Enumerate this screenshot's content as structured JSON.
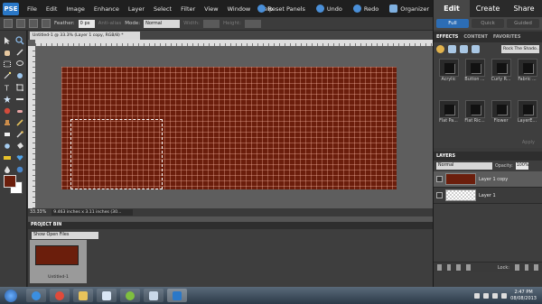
{
  "menubar": {
    "logo_text": "PSE",
    "items": [
      "File",
      "Edit",
      "Image",
      "Enhance",
      "Layer",
      "Select",
      "Filter",
      "View",
      "Window",
      "Help"
    ],
    "actions": [
      {
        "label": "Reset Panels",
        "icon": "reset-panels-icon"
      },
      {
        "label": "Undo",
        "icon": "undo-icon"
      },
      {
        "label": "Redo",
        "icon": "redo-icon"
      },
      {
        "label": "Organizer",
        "icon": "organizer-icon"
      }
    ]
  },
  "options_bar": {
    "feather_label": "Feather:",
    "feather_value": "0 px",
    "anti_alias_label": "Anti-alias",
    "mode_label": "Mode:",
    "mode_value": "Normal",
    "width_label": "Width:",
    "height_label": "Height:"
  },
  "right_panel": {
    "mode_tabs": [
      "Edit",
      "Create",
      "Share"
    ],
    "sub_tabs": [
      "Full",
      "Quick",
      "Guided"
    ],
    "effects_tabs": [
      "EFFECTS",
      "CONTENT",
      "FAVORITES"
    ],
    "effects_filter": "Rock The Shado...",
    "thumbs": [
      "Acrylic",
      "Button ...",
      "Curly R...",
      "Fabric ...",
      "Flat Pa...",
      "Flat Ric...",
      "Flower",
      "LayerE..."
    ],
    "apply_label": "Apply",
    "layers": {
      "header": "LAYERS",
      "blend_mode": "Normal",
      "opacity_label": "Opacity:",
      "opacity_value": "100%",
      "rows": [
        {
          "name": "Layer 1 copy",
          "active": true
        },
        {
          "name": "Layer 1",
          "active": false
        }
      ],
      "lock_label": "Lock:"
    }
  },
  "document": {
    "tab_title": "Untitled-1 @ 33.3% (Layer 1 copy, RGB/8) *",
    "zoom": "33.33%",
    "info": "9.463 inches x 3.11 inches (30..."
  },
  "project_bin": {
    "header": "PROJECT BIN",
    "dropdown": "Show Open Files",
    "items": [
      {
        "caption": "Untitled-1"
      }
    ]
  },
  "taskbar": {
    "time": "2:47 PM",
    "date": "08/08/2013"
  },
  "colors": {
    "canvas_brown": "#6b1e0c",
    "accent_blue": "#2c6db5"
  }
}
